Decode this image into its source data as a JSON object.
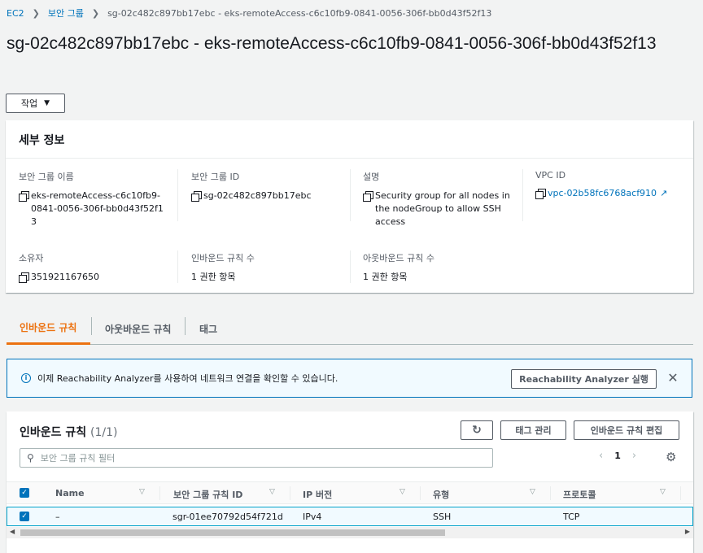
{
  "breadcrumb": {
    "items": [
      "EC2",
      "보안 그룹"
    ],
    "current": "sg-02c482c897bb17ebc - eks-remoteAccess-c6c10fb9-0841-0056-306f-bb0d43f52f13"
  },
  "page_title": "sg-02c482c897bb17ebc - eks-remoteAccess-c6c10fb9-0841-0056-306f-bb0d43f52f13",
  "action_button": "작업",
  "details": {
    "heading": "세부 정보",
    "group_name_label": "보안 그룹 이름",
    "group_name": "eks-remoteAccess-c6c10fb9-0841-0056-306f-bb0d43f52f13",
    "group_id_label": "보안 그룹 ID",
    "group_id": "sg-02c482c897bb17ebc",
    "desc_label": "설명",
    "desc": "Security group for all nodes in the nodeGroup to allow SSH access",
    "vpc_label": "VPC ID",
    "vpc": "vpc-02b58fc6768acf910",
    "owner_label": "소유자",
    "owner": "351921167650",
    "inbound_count_label": "인바운드 규칙 수",
    "inbound_count": "1 권한 항목",
    "outbound_count_label": "아웃바운드 규칙 수",
    "outbound_count": "1 권한 항목"
  },
  "tabs": [
    "인바운드 규칙",
    "아웃바운드 규칙",
    "태그"
  ],
  "alert": {
    "text": "이제 Reachability Analyzer를 사용하여 네트워크 연결을 확인할 수 있습니다.",
    "button": "Reachability Analyzer 실행"
  },
  "rules": {
    "title": "인바운드 규칙",
    "count": "(1/1)",
    "tag_button": "태그 관리",
    "edit_button": "인바운드 규칙 편집",
    "filter_placeholder": "보안 그룹 규칙 필터",
    "page": "1",
    "columns": [
      "Name",
      "보안 그룹 규칙 ID",
      "IP 버전",
      "유형",
      "프로토콜"
    ],
    "rows": [
      {
        "name": "–",
        "rule_id": "sgr-01ee70792d54f721d",
        "ip_version": "IPv4",
        "type": "SSH",
        "protocol": "TCP"
      }
    ]
  },
  "colors": {
    "link": "#0073bb",
    "active_tab": "#ec7211",
    "info_bg": "#f1faff"
  }
}
